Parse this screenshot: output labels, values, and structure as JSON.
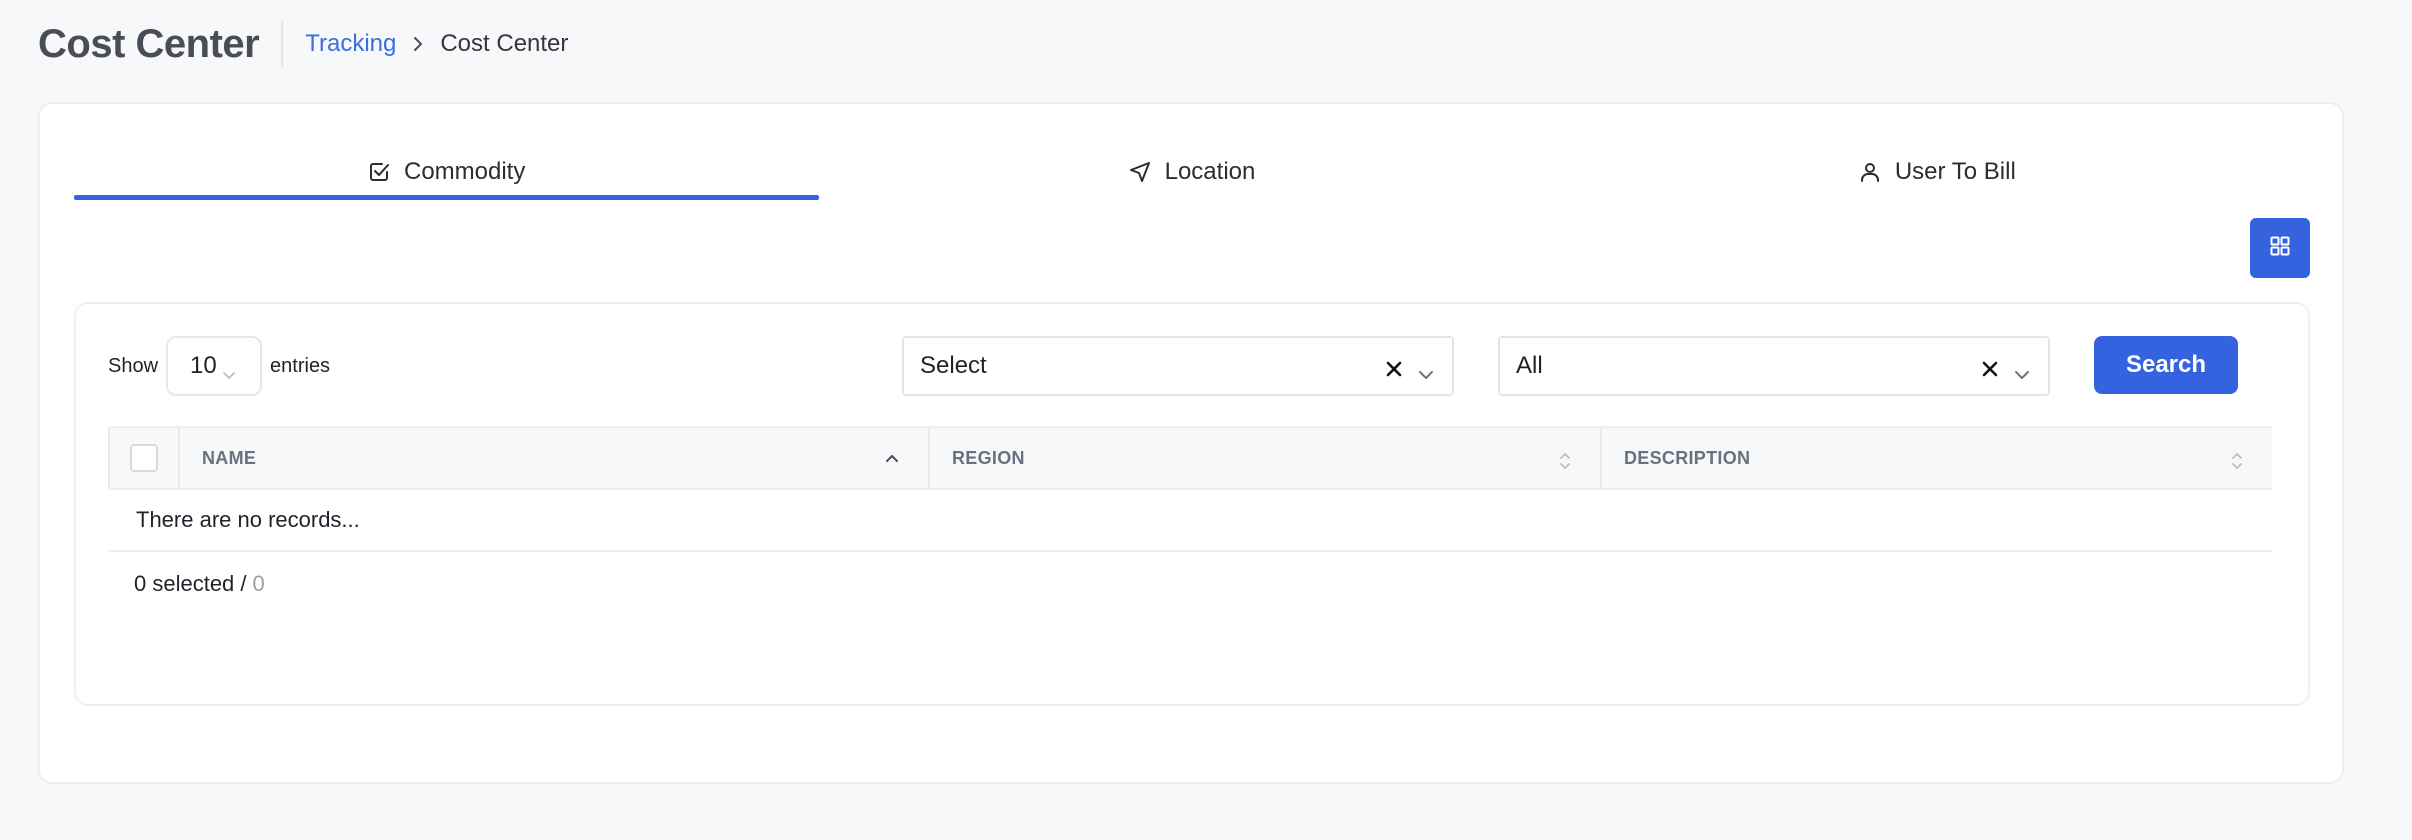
{
  "header": {
    "title": "Cost Center",
    "breadcrumb": {
      "link": "Tracking",
      "current": "Cost Center"
    }
  },
  "tabs": [
    {
      "label": "Commodity",
      "icon": "checkbox-icon",
      "active": true
    },
    {
      "label": "Location",
      "icon": "navigation-arrow-icon",
      "active": false
    },
    {
      "label": "User To Bill",
      "icon": "user-icon",
      "active": false
    }
  ],
  "toolbar": {
    "view_toggle_icon": "grid-icon"
  },
  "controls": {
    "show_label": "Show",
    "entries_value": "10",
    "entries_label": "entries",
    "filter1_value": "Select",
    "filter2_value": "All",
    "search_label": "Search"
  },
  "table": {
    "columns": [
      "NAME",
      "REGION",
      "DESCRIPTION"
    ],
    "empty_message": "There are no records...",
    "selected_text": "0 selected /",
    "total": "0"
  },
  "colors": {
    "accent": "#3563e0",
    "link": "#3b6ee0"
  }
}
